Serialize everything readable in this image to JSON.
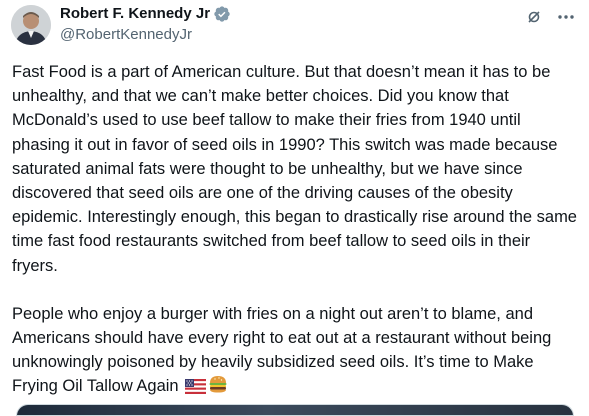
{
  "post": {
    "author": {
      "name": "Robert F. Kennedy Jr",
      "handle": "@RobertKennedyJr",
      "verified_color": "#829aab"
    },
    "icons": {
      "verified": "verified-badge-icon",
      "grok": "grok-icon",
      "more": "more-options-icon"
    },
    "paragraphs": [
      "Fast Food is a part of American culture. But that doesn’t mean it has to be unhealthy, and that we can’t make better choices. Did you know that McDonald’s used to use beef tallow to make their fries from 1940 until phasing it out in favor of seed oils in 1990? This switch was made because saturated animal fats were thought to be unhealthy, but we have since discovered that seed oils are one of the driving causes of the obesity epidemic. Interestingly enough, this began to drastically rise around the same time fast food restaurants switched from beef tallow to seed oils in their fryers.",
      "People who enjoy a burger with fries on a night out aren’t to blame, and Americans should have every right to eat out at a restaurant without being unknowingly poisoned by heavily subsidized seed oils. It’s time to Make Frying Oil Tallow Again"
    ],
    "emojis": [
      "us-flag-emoji",
      "hamburger-emoji"
    ],
    "colors": {
      "text": "#0f1419",
      "secondary": "#536471",
      "border": "#cfd9de"
    }
  }
}
